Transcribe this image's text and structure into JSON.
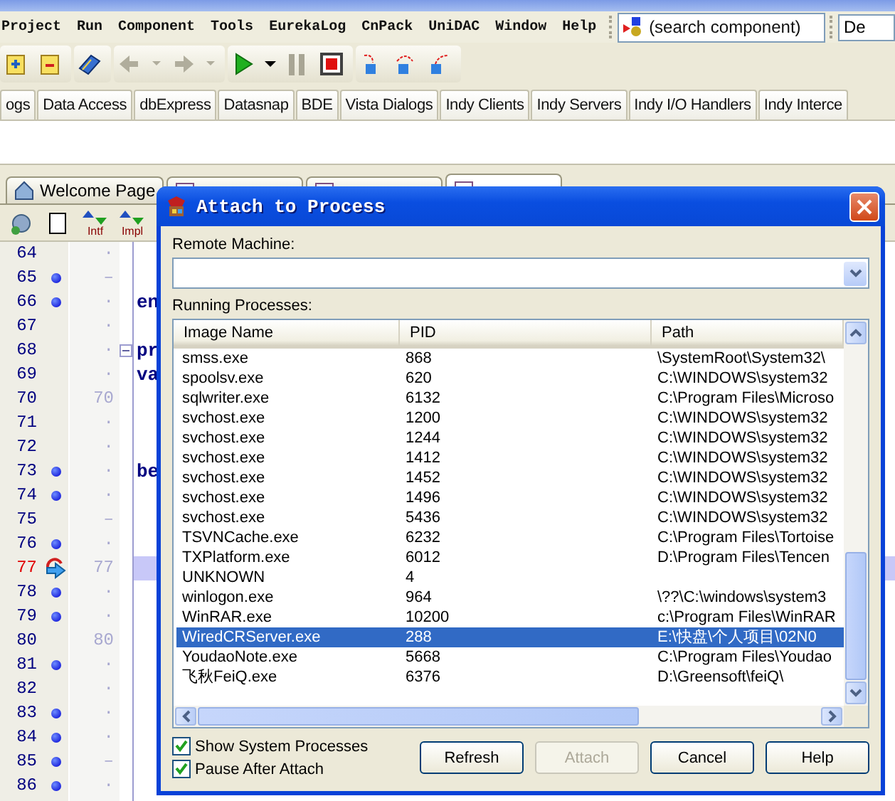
{
  "menu": [
    "Project",
    "Run",
    "Component",
    "Tools",
    "EurekaLog",
    "CnPack",
    "UniDAC",
    "Window",
    "Help"
  ],
  "search": {
    "placeholder": "(search component)"
  },
  "layout_field": {
    "value": "De"
  },
  "palette_tabs": [
    "ogs",
    "Data Access",
    "dbExpress",
    "Datasnap",
    "BDE",
    "Vista Dialogs",
    "Indy Clients",
    "Indy Servers",
    "Indy I/O Handlers",
    "Indy Interce"
  ],
  "editor_tabs": [
    {
      "label": "Welcome Page",
      "selected": false
    },
    {
      "selected": false
    },
    {
      "selected": false
    },
    {
      "selected": true
    }
  ],
  "editor_toolbar": {
    "intf": "Intf",
    "impl": "Impl"
  },
  "code_lines": [
    {
      "number": "64",
      "kind": "plain",
      "mark": "·",
      "fold": false,
      "current": false
    },
    {
      "number": "65",
      "kind": "breakpoint",
      "mark": "–",
      "fold": false,
      "current": false
    },
    {
      "number": "66",
      "kind": "breakpoint",
      "mark": "·",
      "code": "en",
      "fold": false,
      "current": false
    },
    {
      "number": "67",
      "kind": "plain",
      "mark": "·",
      "fold": false,
      "current": false
    },
    {
      "number": "68",
      "kind": "plain",
      "mark": "·",
      "code": "pr",
      "fold": true,
      "current": false
    },
    {
      "number": "69",
      "kind": "plain",
      "mark": "·",
      "code": "va",
      "fold": false,
      "current": false
    },
    {
      "number": "70",
      "kind": "plain",
      "mark": "70",
      "fold": false,
      "current": false
    },
    {
      "number": "71",
      "kind": "plain",
      "mark": "·",
      "fold": false,
      "current": false
    },
    {
      "number": "72",
      "kind": "plain",
      "mark": "·",
      "fold": false,
      "current": false
    },
    {
      "number": "73",
      "kind": "breakpoint",
      "mark": "·",
      "code": "be",
      "fold": false,
      "current": false
    },
    {
      "number": "74",
      "kind": "breakpoint",
      "mark": "·",
      "fold": false,
      "current": false
    },
    {
      "number": "75",
      "kind": "plain",
      "mark": "–",
      "fold": false,
      "current": false
    },
    {
      "number": "76",
      "kind": "breakpoint",
      "mark": "·",
      "fold": false,
      "current": false
    },
    {
      "number": "77",
      "kind": "execution",
      "mark": "77",
      "fold": false,
      "current": true
    },
    {
      "number": "78",
      "kind": "breakpoint",
      "mark": "·",
      "fold": false,
      "current": false
    },
    {
      "number": "79",
      "kind": "breakpoint",
      "mark": "·",
      "fold": false,
      "current": false
    },
    {
      "number": "80",
      "kind": "plain",
      "mark": "80",
      "fold": false,
      "current": false
    },
    {
      "number": "81",
      "kind": "breakpoint",
      "mark": "·",
      "fold": false,
      "current": false
    },
    {
      "number": "82",
      "kind": "plain",
      "mark": "·",
      "fold": false,
      "current": false
    },
    {
      "number": "83",
      "kind": "breakpoint",
      "mark": "·",
      "fold": false,
      "current": false
    },
    {
      "number": "84",
      "kind": "breakpoint",
      "mark": "·",
      "fold": false,
      "current": false
    },
    {
      "number": "85",
      "kind": "breakpoint",
      "mark": "–",
      "fold": false,
      "current": false
    },
    {
      "number": "86",
      "kind": "breakpoint",
      "mark": "·",
      "fold": false,
      "current": false
    }
  ],
  "dialog": {
    "title": "Attach to Process",
    "remote_machine_label": "Remote Machine:",
    "processes_label": "Running Processes:",
    "columns": [
      "Image Name",
      "PID",
      "Path"
    ],
    "rows": [
      {
        "name": "smss.exe",
        "pid": "868",
        "path": "\\SystemRoot\\System32\\",
        "selected": false
      },
      {
        "name": "spoolsv.exe",
        "pid": "620",
        "path": "C:\\WINDOWS\\system32",
        "selected": false
      },
      {
        "name": "sqlwriter.exe",
        "pid": "6132",
        "path": "C:\\Program Files\\Microso",
        "selected": false
      },
      {
        "name": "svchost.exe",
        "pid": "1200",
        "path": "C:\\WINDOWS\\system32",
        "selected": false
      },
      {
        "name": "svchost.exe",
        "pid": "1244",
        "path": "C:\\WINDOWS\\system32",
        "selected": false
      },
      {
        "name": "svchost.exe",
        "pid": "1412",
        "path": "C:\\WINDOWS\\system32",
        "selected": false
      },
      {
        "name": "svchost.exe",
        "pid": "1452",
        "path": "C:\\WINDOWS\\system32",
        "selected": false
      },
      {
        "name": "svchost.exe",
        "pid": "1496",
        "path": "C:\\WINDOWS\\system32",
        "selected": false
      },
      {
        "name": "svchost.exe",
        "pid": "5436",
        "path": "C:\\WINDOWS\\system32",
        "selected": false
      },
      {
        "name": "TSVNCache.exe",
        "pid": "6232",
        "path": "C:\\Program Files\\Tortoise",
        "selected": false
      },
      {
        "name": "TXPlatform.exe",
        "pid": "6012",
        "path": "D:\\Program Files\\Tencen",
        "selected": false
      },
      {
        "name": "UNKNOWN",
        "pid": "4",
        "selected": false
      },
      {
        "name": "winlogon.exe",
        "pid": "964",
        "path": "\\??\\C:\\windows\\system3",
        "selected": false
      },
      {
        "name": "WinRAR.exe",
        "pid": "10200",
        "path": "c:\\Program Files\\WinRAR",
        "selected": false
      },
      {
        "name": "WiredCRServer.exe",
        "pid": "288",
        "path": "E:\\快盘\\个人项目\\02N0",
        "selected": true
      },
      {
        "name": "YoudaoNote.exe",
        "pid": "5668",
        "path": "C:\\Program Files\\Youdao",
        "selected": false
      },
      {
        "name": "飞秋FeiQ.exe",
        "pid": "6376",
        "path": "D:\\Greensoft\\feiQ\\",
        "selected": false
      }
    ],
    "options": [
      {
        "label": "Show System Processes",
        "checked": true
      },
      {
        "label": "Pause After Attach",
        "checked": true
      }
    ],
    "buttons": [
      {
        "label": "Refresh",
        "disabled": false
      },
      {
        "label": "Attach",
        "disabled": true
      },
      {
        "label": "Cancel",
        "disabled": false
      },
      {
        "label": "Help",
        "disabled": false
      }
    ]
  }
}
